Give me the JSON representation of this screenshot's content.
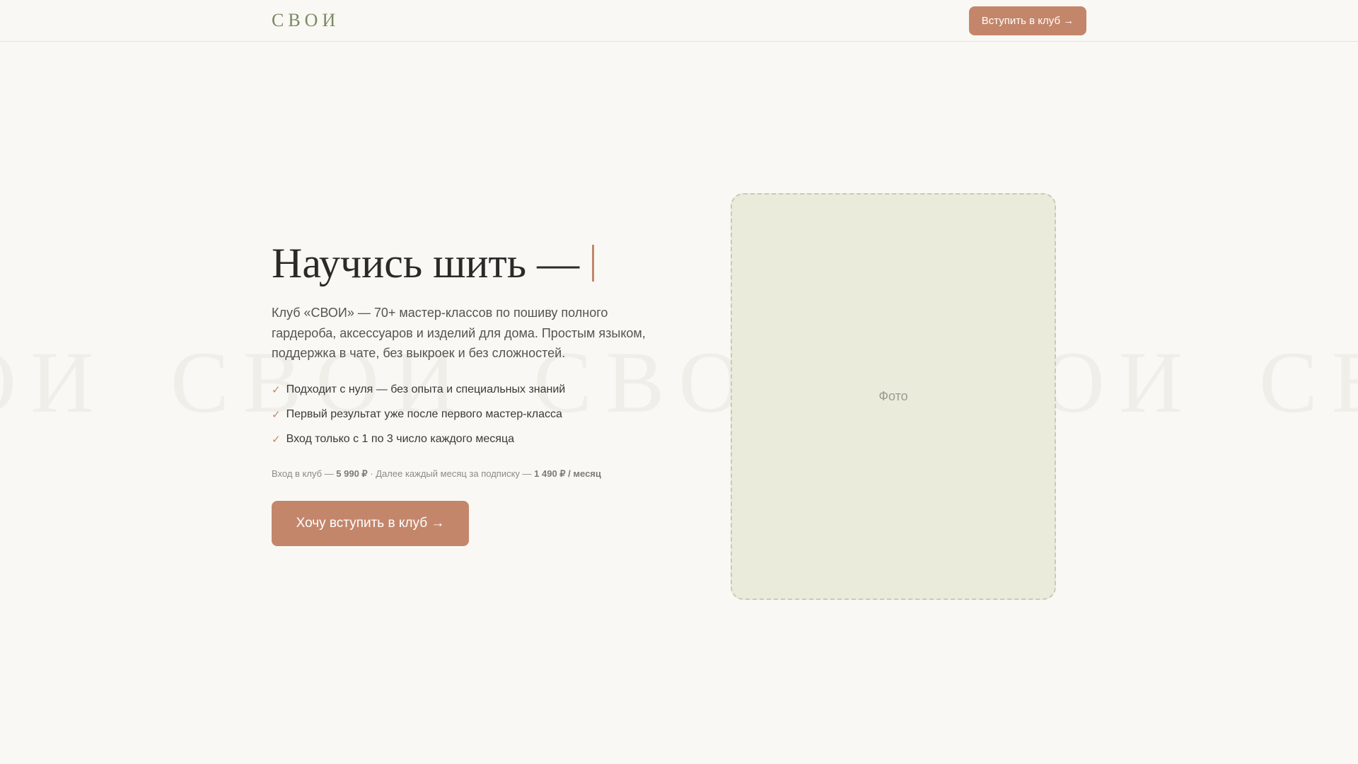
{
  "header": {
    "logo": "СВОИ",
    "join_button": "Вступить в клуб →"
  },
  "watermark": {
    "text": "СВОИ"
  },
  "hero": {
    "title": "Научись шить —",
    "description": "Клуб «СВОИ» — 70+ мастер-классов по пошиву полного гардероба, аксессуаров и изделий для дома. Простым языком, поддержка в чате, без выкроек и без сложностей.",
    "features": [
      "Подходит с нуля — без опыта и специальных знаний",
      "Первый результат уже после первого мастер-класса",
      "Вход только с 1 по 3 число каждого месяца"
    ],
    "check_icon": "✓",
    "price": {
      "entry_label": "Вход в клуб — ",
      "entry_value": "5 990 ₽",
      "sub_label": " · Далее каждый месяц за подписку — ",
      "sub_value": "1 490 ₽ / месяц"
    },
    "cta": "Хочу вступить в клуб →"
  },
  "photo": {
    "placeholder": "Фото"
  },
  "colors": {
    "accent": "#c3866b",
    "logo": "#7a8a63",
    "background": "#f9f8f4",
    "photo_bg": "#eaebdb"
  }
}
